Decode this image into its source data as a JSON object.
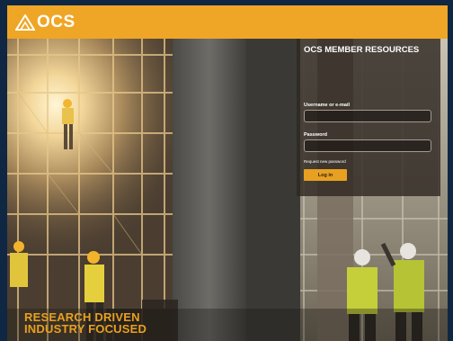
{
  "brand": {
    "name": "OCS",
    "tagline": "",
    "accent_color": "#efa626"
  },
  "hero": {
    "tagline_line1": "RESEARCH DRIVEN",
    "tagline_line2": "INDUSTRY FOCUSED"
  },
  "login": {
    "title": "OCS MEMBER RESOURCES",
    "username_label": "Username or e-mail",
    "username_value": "",
    "password_label": "Password",
    "password_value": "",
    "request_password": "Request new password",
    "login_button": "Log in"
  }
}
